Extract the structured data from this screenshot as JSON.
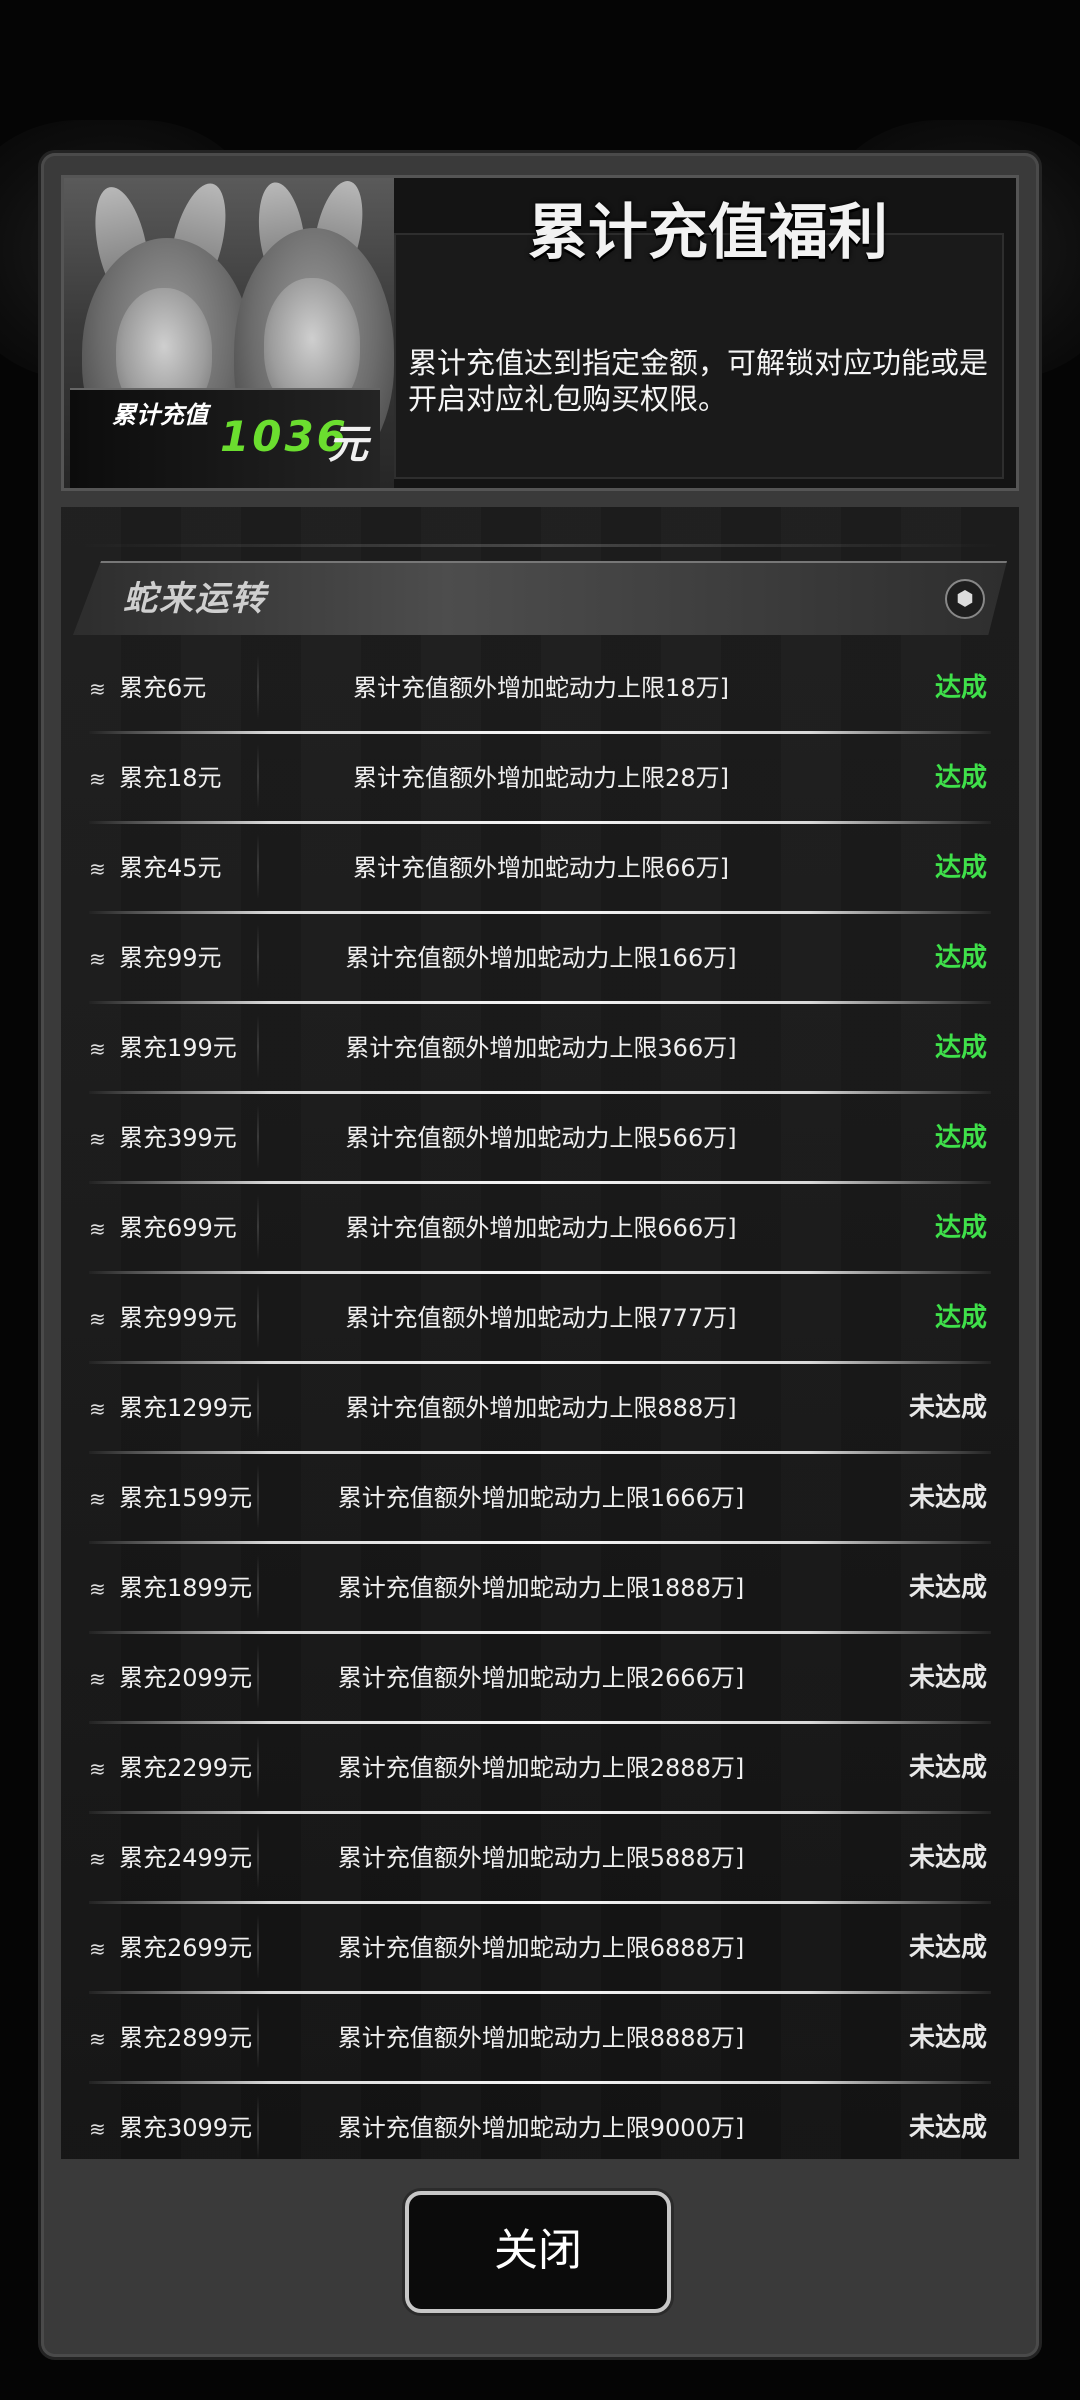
{
  "header": {
    "title": "累计充值福利",
    "description": "累计充值达到指定金额，可解锁对应功能或是开启对应礼包购买权限。",
    "total_label": "累计充值",
    "total_value": "1036",
    "total_unit": "元"
  },
  "section": {
    "title": "蛇来运转",
    "icon": "hexagon-icon"
  },
  "colors": {
    "achieved": "#3fe04a",
    "not_achieved": "#e8e8e8"
  },
  "rows": [
    {
      "threshold": "累充6元",
      "reward": "累计充值额外增加蛇动力上限18万]",
      "status": "达成"
    },
    {
      "threshold": "累充18元",
      "reward": "累计充值额外增加蛇动力上限28万]",
      "status": "达成"
    },
    {
      "threshold": "累充45元",
      "reward": "累计充值额外增加蛇动力上限66万]",
      "status": "达成"
    },
    {
      "threshold": "累充99元",
      "reward": "累计充值额外增加蛇动力上限166万]",
      "status": "达成"
    },
    {
      "threshold": "累充199元",
      "reward": "累计充值额外增加蛇动力上限366万]",
      "status": "达成"
    },
    {
      "threshold": "累充399元",
      "reward": "累计充值额外增加蛇动力上限566万]",
      "status": "达成"
    },
    {
      "threshold": "累充699元",
      "reward": "累计充值额外增加蛇动力上限666万]",
      "status": "达成"
    },
    {
      "threshold": "累充999元",
      "reward": "累计充值额外增加蛇动力上限777万]",
      "status": "达成"
    },
    {
      "threshold": "累充1299元",
      "reward": "累计充值额外增加蛇动力上限888万]",
      "status": "未达成"
    },
    {
      "threshold": "累充1599元",
      "reward": "累计充值额外增加蛇动力上限1666万]",
      "status": "未达成"
    },
    {
      "threshold": "累充1899元",
      "reward": "累计充值额外增加蛇动力上限1888万]",
      "status": "未达成"
    },
    {
      "threshold": "累充2099元",
      "reward": "累计充值额外增加蛇动力上限2666万]",
      "status": "未达成"
    },
    {
      "threshold": "累充2299元",
      "reward": "累计充值额外增加蛇动力上限2888万]",
      "status": "未达成"
    },
    {
      "threshold": "累充2499元",
      "reward": "累计充值额外增加蛇动力上限5888万]",
      "status": "未达成"
    },
    {
      "threshold": "累充2699元",
      "reward": "累计充值额外增加蛇动力上限6888万]",
      "status": "未达成"
    },
    {
      "threshold": "累充2899元",
      "reward": "累计充值额外增加蛇动力上限8888万]",
      "status": "未达成"
    },
    {
      "threshold": "累充3099元",
      "reward": "累计充值额外增加蛇动力上限9000万]",
      "status": "未达成"
    }
  ],
  "close_button": "关闭"
}
